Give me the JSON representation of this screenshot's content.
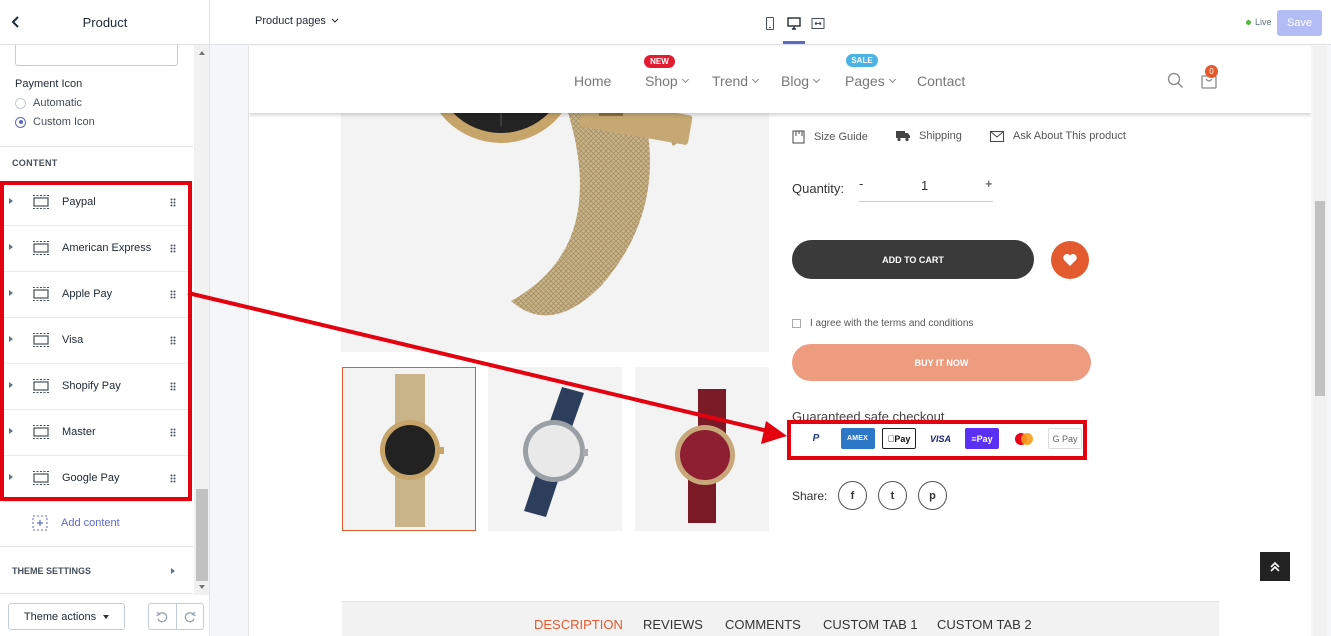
{
  "sidebar": {
    "title": "Product",
    "payment_icon_label": "Payment Icon",
    "radios": [
      {
        "label": "Automatic",
        "selected": false
      },
      {
        "label": "Custom Icon",
        "selected": true
      }
    ],
    "content_heading": "CONTENT",
    "blocks": [
      {
        "label": "Paypal"
      },
      {
        "label": "American Express"
      },
      {
        "label": "Apple Pay"
      },
      {
        "label": "Visa"
      },
      {
        "label": "Shopify Pay"
      },
      {
        "label": "Master"
      },
      {
        "label": "Google Pay"
      }
    ],
    "add_content": "Add content",
    "theme_settings": "THEME SETTINGS",
    "theme_actions": "Theme actions"
  },
  "topbar": {
    "page_select": "Product pages",
    "live": "Live",
    "save": "Save"
  },
  "store": {
    "nav": [
      "Home",
      "Shop",
      "Trend",
      "Blog",
      "Pages",
      "Contact"
    ],
    "badge_new": "NEW",
    "badge_sale": "SALE",
    "cart_count": "0",
    "links": [
      "Size Guide",
      "Shipping",
      "Ask About This product"
    ],
    "quantity_label": "Quantity:",
    "quantity_minus": "-",
    "quantity_value": "1",
    "quantity_plus": "+",
    "add_to_cart": "ADD TO CART",
    "terms": "I agree with the terms and conditions",
    "buy_now": "BUY IT NOW",
    "safe_checkout": "Guaranteed safe checkout",
    "payment_icons": [
      "P",
      "AMEX",
      "Pay",
      "VISA",
      "≡Pay",
      "",
      "G Pay"
    ],
    "share_label": "Share:",
    "share_icons": [
      "f",
      "t",
      "p"
    ],
    "tabs": [
      "DESCRIPTION",
      "REVIEWS",
      "COMMENTS",
      "CUSTOM TAB 1",
      "CUSTOM TAB 2"
    ]
  },
  "colors": {
    "accent": "#e45a2f",
    "annotation_red": "#e3000f",
    "editor_indigo": "#5c6ac4"
  }
}
